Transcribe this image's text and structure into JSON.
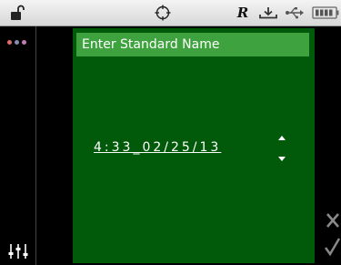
{
  "status_bar": {
    "lock_icon": "unlocked-padlock-icon",
    "target_icon": "crosshair-target-icon",
    "mode_label": "R",
    "tray_icon": "tray-download-icon",
    "usb_icon": "usb-icon",
    "battery_icon": "battery-icon"
  },
  "left_panel": {
    "dots_icon": "three-dots-menu-icon",
    "dot_colors": [
      "#e26b6b",
      "#8e8ab8",
      "#c77db4"
    ],
    "settings_icon": "sliders-icon"
  },
  "form": {
    "name_field_label": "Enter Standard Name",
    "datetime_value": "4:33_02/25/13"
  },
  "actions": {
    "cancel_icon": "x-cancel-icon",
    "confirm_icon": "checkmark-icon"
  },
  "colors": {
    "main_bg": "#005a0a",
    "field_bg": "#3ea33e",
    "action_gray": "#8a8a8a"
  }
}
